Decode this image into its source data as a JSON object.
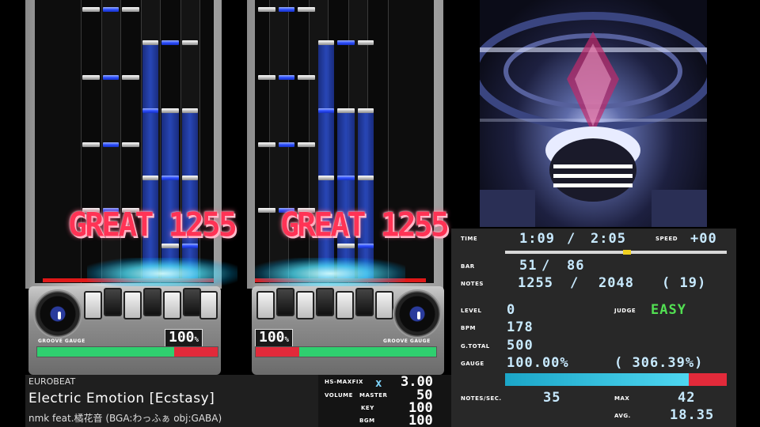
{
  "judge": {
    "left_text": "GREAT",
    "left_combo": "1255",
    "right_text": "GREAT",
    "right_combo": "1255"
  },
  "gauge": {
    "title": "GROOVE GAUGE",
    "percent": "100",
    "percent_unit": "%",
    "fill_fraction": 1.0
  },
  "song": {
    "genre": "EUROBEAT",
    "title": "Electric Emotion [Ecstasy]",
    "artist": "nmk feat.橘花音 (BGA:わっふぁ obj:GABA)"
  },
  "options": {
    "hs_label": "HS-MAXFIX",
    "hs_x": "x",
    "hs_value": "3.00",
    "volume_label": "VOLUME",
    "master_label": "MASTER",
    "master_value": "50",
    "key_label": "KEY",
    "key_value": "100",
    "bgm_label": "BGM",
    "bgm_value": "100"
  },
  "stats": {
    "time_label": "TIME",
    "time_current": "1:09",
    "time_sep": "/",
    "time_total": "2:05",
    "speed_label": "SPEED",
    "speed_value": "+00",
    "progress_fraction": 0.55,
    "bar_label": "BAR",
    "bar_current": "51",
    "bar_sep": "/",
    "bar_total": "86",
    "notes_label": "NOTES",
    "notes_current": "1255",
    "notes_sep": "/",
    "notes_total": "2048",
    "notes_extra": "( 19)",
    "level_label": "LEVEL",
    "level_value": "0",
    "judge_label": "JUDGE",
    "judge_value": "EASY",
    "bpm_label": "BPM",
    "bpm_value": "178",
    "gtotal_label": "G.TOTAL",
    "gtotal_value": "500",
    "gauge_label": "GAUGE",
    "gauge_value": "100.00%",
    "gauge_extra": "( 306.39%)",
    "gauge_fraction": 0.83,
    "nps_label": "NOTES/SEC.",
    "nps_value": "35",
    "max_label": "MAX",
    "max_value": "42",
    "avg_label": "AVG.",
    "avg_value": "18.35"
  },
  "colors": {
    "judge_red": "#ff3355",
    "gauge_green": "#2fcf6f",
    "gauge_red": "#e22a3a",
    "stat_cyan": "#c8eaff",
    "easy_green": "#52e052",
    "progress_marker": "#f0d020"
  }
}
